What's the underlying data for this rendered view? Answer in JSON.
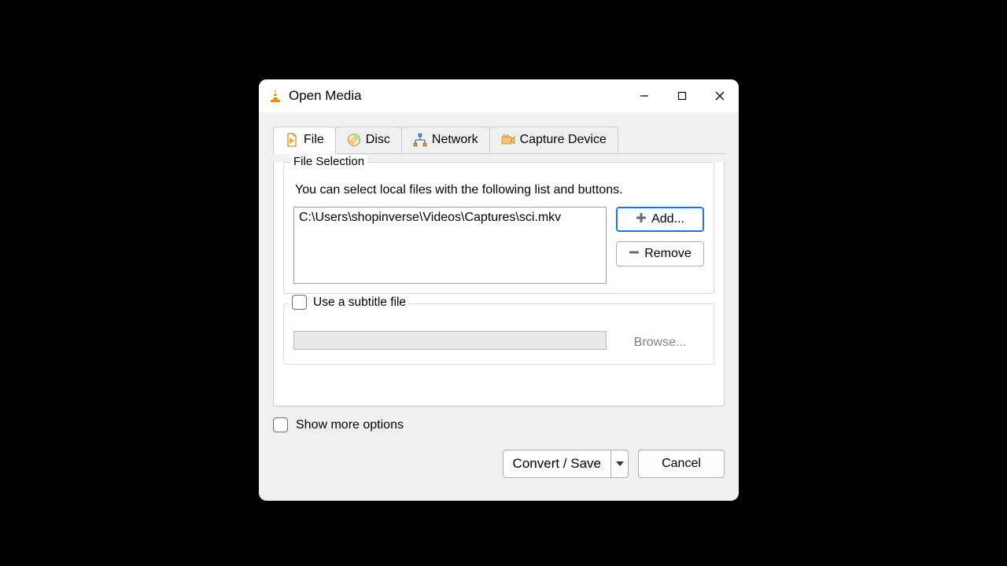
{
  "window": {
    "title": "Open Media"
  },
  "tabs": {
    "file": "File",
    "disc": "Disc",
    "network": "Network",
    "capture": "Capture Device"
  },
  "fileSelection": {
    "legend": "File Selection",
    "hint": "You can select local files with the following list and buttons.",
    "files": [
      "C:\\Users\\shopinverse\\Videos\\Captures\\sci.mkv"
    ],
    "addLabel": "Add...",
    "removeLabel": "Remove"
  },
  "subtitle": {
    "label": "Use a subtitle file",
    "browse": "Browse..."
  },
  "showMoreLabel": "Show more options",
  "convertSaveLabel": "Convert / Save",
  "cancelLabel": "Cancel"
}
